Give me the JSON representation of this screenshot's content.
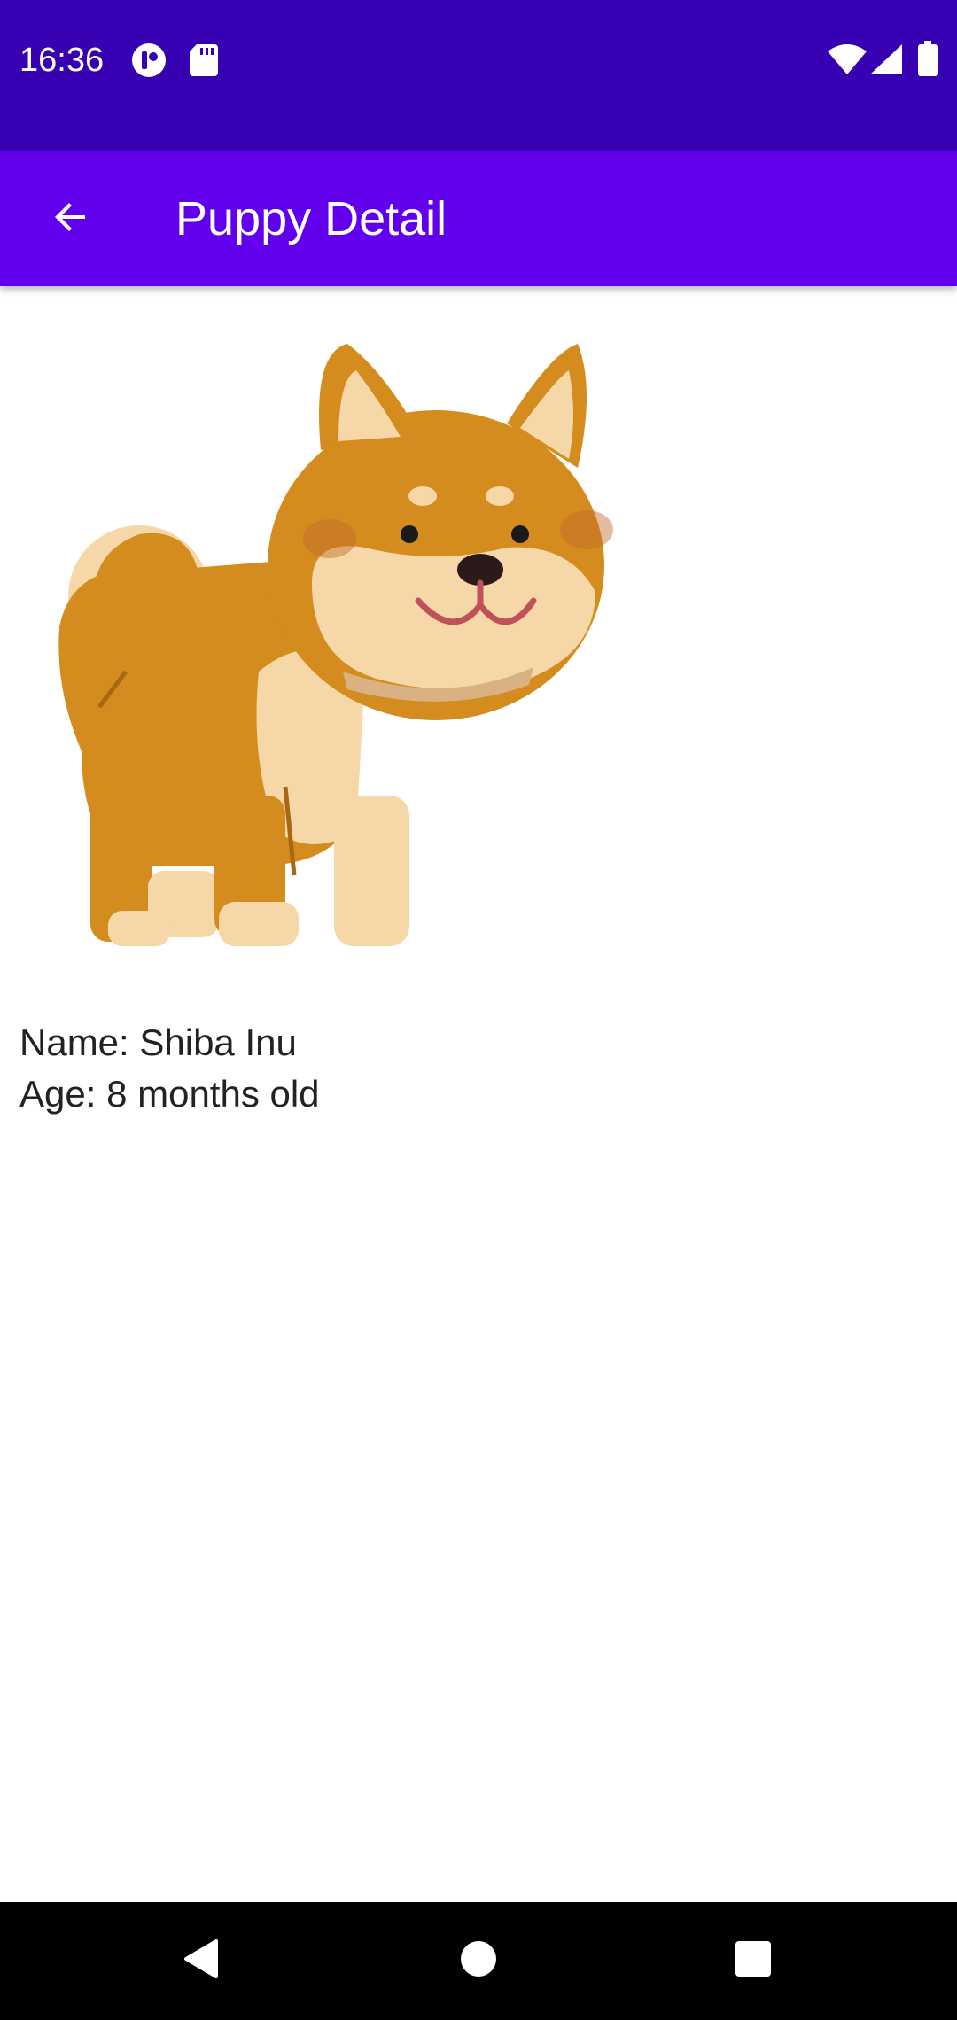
{
  "status_bar": {
    "time": "16:36",
    "icons": [
      "app-notification-icon",
      "sd-card-icon",
      "wifi-icon",
      "cellular-signal-icon",
      "battery-icon"
    ],
    "background": "#3700B3"
  },
  "app_bar": {
    "title": "Puppy Detail",
    "back_icon": "arrow-back-icon",
    "background": "#6200EE"
  },
  "puppy": {
    "image": "shiba-inu-illustration",
    "name_line": "Name: Shiba Inu",
    "age_line": "Age: 8 months old"
  },
  "nav_bar": {
    "buttons": [
      "back-triangle-icon",
      "home-circle-icon",
      "recents-square-icon"
    ]
  }
}
